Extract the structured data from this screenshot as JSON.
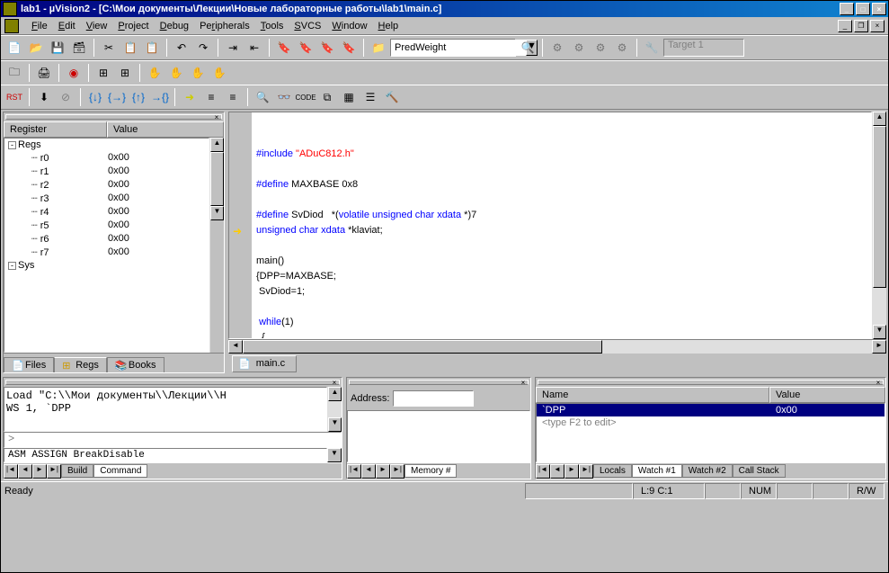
{
  "title": "lab1  - µVision2 - [C:\\Мои документы\\Лекции\\Новые лабораторные работы\\lab1\\main.c]",
  "menu": [
    "File",
    "Edit",
    "View",
    "Project",
    "Debug",
    "Peripherals",
    "Tools",
    "SVCS",
    "Window",
    "Help"
  ],
  "combo_pred": "PredWeight",
  "target_combo": "Target 1",
  "registers": {
    "header": {
      "col1": "Register",
      "col2": "Value"
    },
    "root": "Regs",
    "rows": [
      {
        "name": "r0",
        "val": "0x00"
      },
      {
        "name": "r1",
        "val": "0x00"
      },
      {
        "name": "r2",
        "val": "0x00"
      },
      {
        "name": "r3",
        "val": "0x00"
      },
      {
        "name": "r4",
        "val": "0x00"
      },
      {
        "name": "r5",
        "val": "0x00"
      },
      {
        "name": "r6",
        "val": "0x00"
      },
      {
        "name": "r7",
        "val": "0x00"
      }
    ],
    "sys": "Sys"
  },
  "left_tabs": [
    "Files",
    "Regs",
    "Books"
  ],
  "editor": {
    "tab": "main.c",
    "l1a": "#include ",
    "l1b": "\"ADuC812.h\"",
    "l3a": "#define",
    "l3b": " MAXBASE 0x8",
    "l5a": "#define",
    "l5b": " SvDiod   *(",
    "l5c": "volatile unsigned char xdata",
    "l5d": " *)7",
    "l6a": "unsigned char xdata",
    "l6b": " *klaviat;",
    "l8": "main()",
    "l9": "{DPP=MAXBASE;",
    "l10": " SvDiod=1;",
    "l12a": " ",
    "l12b": "while",
    "l12c": "(1)",
    "l13": "  {"
  },
  "command": {
    "output": "Load \"C:\\\\Мои документы\\\\Лекции\\\\Н\nWS 1, `DPP",
    "prompt": ">",
    "hint": "ASM ASSIGN BreakDisable",
    "tabs": [
      "Build",
      "Command"
    ]
  },
  "memory": {
    "label": "Address:",
    "tab": "Memory #"
  },
  "watch": {
    "header": {
      "c1": "Name",
      "c2": "Value"
    },
    "rows": [
      {
        "name": "`DPP",
        "val": "0x00",
        "sel": true
      },
      {
        "name": "<type F2 to edit>",
        "val": "",
        "sel": false
      }
    ],
    "tabs": [
      "Locals",
      "Watch #1",
      "Watch #2",
      "Call Stack"
    ]
  },
  "status": {
    "ready": "Ready",
    "pos": "L:9 C:1",
    "num": "NUM",
    "rw": "R/W"
  }
}
